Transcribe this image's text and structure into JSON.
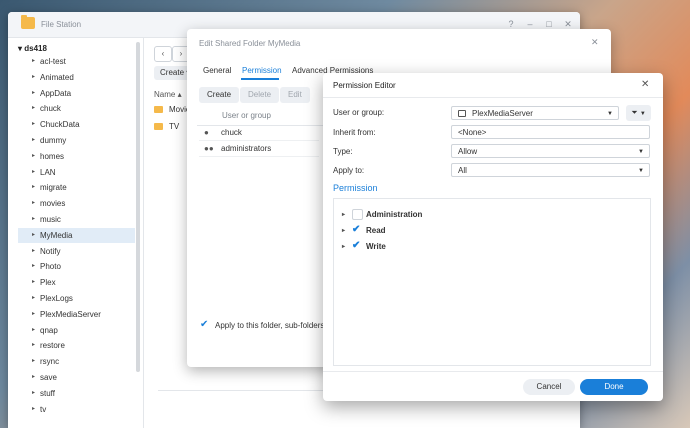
{
  "file_station": {
    "title": "File Station",
    "window_buttons": [
      "?",
      "–",
      "□",
      "✕"
    ],
    "root": "ds418",
    "tree": [
      "acl-test",
      "Animated",
      "AppData",
      "chuck",
      "ChuckData",
      "dummy",
      "homes",
      "LAN",
      "migrate",
      "movies",
      "music",
      "MyMedia",
      "Notify",
      "Photo",
      "Plex",
      "PlexLogs",
      "PlexMediaServer",
      "qnap",
      "restore",
      "rsync",
      "save",
      "stuff",
      "tv"
    ],
    "selected": "MyMedia",
    "back": "‹",
    "forward": "›",
    "create_label": "Create ▾",
    "col_name": "Name ▴",
    "files": [
      "Movie",
      "TV"
    ]
  },
  "edit_folder": {
    "title": "Edit Shared Folder MyMedia",
    "close": "✕",
    "tabs": [
      "General",
      "Permission",
      "Advanced Permissions"
    ],
    "active_tab": "Permission",
    "buttons": [
      "Create",
      "Delete",
      "Edit"
    ],
    "col_user": "User or group",
    "users": [
      "chuck",
      "administrators"
    ],
    "apply_text": "Apply to this folder, sub-folders a"
  },
  "permission_editor": {
    "title": "Permission Editor",
    "close": "✕",
    "user_label": "User or group:",
    "user_value": "PlexMediaServer",
    "inherit_label": "Inherit from:",
    "inherit_value": "<None>",
    "type_label": "Type:",
    "type_value": "Allow",
    "apply_label": "Apply to:",
    "apply_value": "All",
    "section": "Permission",
    "permissions": [
      {
        "label": "Administration",
        "checked": false
      },
      {
        "label": "Read",
        "checked": true
      },
      {
        "label": "Write",
        "checked": true
      }
    ],
    "cancel": "Cancel",
    "done": "Done"
  },
  "icons": [
    "folder-icon",
    "user-icon",
    "group-icon",
    "filter-icon",
    "checkmark-icon",
    "chevron-down-icon",
    "triangle-right-icon",
    "close-icon"
  ],
  "colors": {
    "accent": "#1a7fd9",
    "folder": "#f5b94a",
    "selection": "#e1ecf7"
  }
}
